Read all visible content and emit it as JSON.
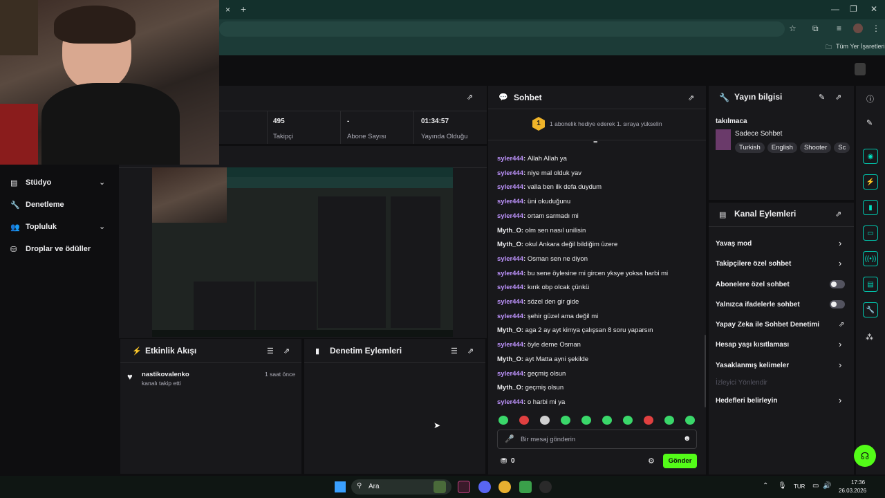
{
  "browser": {
    "bookmarks_label": "Tüm Yer İşaretleri",
    "tab_close": "×",
    "tab_new": "+"
  },
  "stats": [
    {
      "value": "495",
      "label": "Takipçi"
    },
    {
      "value": "-",
      "label": "Abone Sayısı"
    },
    {
      "value": "01:34:57",
      "label": "Yayında Olduğu"
    }
  ],
  "sidebar": {
    "items": [
      {
        "label": "Stüdyo",
        "icon": "studio-icon",
        "expandable": true
      },
      {
        "label": "Denetleme",
        "icon": "wrench-icon",
        "expandable": false
      },
      {
        "label": "Topluluk",
        "icon": "community-icon",
        "expandable": true
      },
      {
        "label": "Droplar ve ödüller",
        "icon": "drops-icon",
        "expandable": false
      }
    ]
  },
  "activity": {
    "title": "Etkinlik Akışı",
    "items": [
      {
        "user": "nastikovalenko",
        "text": "kanalı takip etti",
        "time": "1 saat önce"
      }
    ]
  },
  "mod_actions": {
    "title": "Denetim Eylemleri"
  },
  "chat": {
    "title": "Sohbet",
    "gift_badge": "1",
    "gift_text": "1 abonelik hediye ederek 1. sıraya yükselin",
    "messages": [
      {
        "user": "syler444",
        "text": "Allah Allah ya",
        "color": "purple"
      },
      {
        "user": "syler444",
        "text": "niye mal olduk yav",
        "color": "purple"
      },
      {
        "user": "syler444",
        "text": "valla ben ilk defa duydum",
        "color": "purple"
      },
      {
        "user": "syler444",
        "text": "üni okuduğunu",
        "color": "purple"
      },
      {
        "user": "syler444",
        "text": "ortam sarmadı mi",
        "color": "purple"
      },
      {
        "user": "Myth_O",
        "text": "olm sen nasıl unilisin",
        "color": "white"
      },
      {
        "user": "Myth_O",
        "text": "okul Ankara değil bildiğim üzere",
        "color": "white"
      },
      {
        "user": "syler444",
        "text": "Osman sen ne diyon",
        "color": "purple"
      },
      {
        "user": "syler444",
        "text": "bu sene öylesine mi gircen yksye yoksa harbi mi",
        "color": "purple"
      },
      {
        "user": "syler444",
        "text": "kırık obp olcak çünkü",
        "color": "purple"
      },
      {
        "user": "syler444",
        "text": "sözel den gir gide",
        "color": "purple"
      },
      {
        "user": "syler444",
        "text": "şehir güzel ama değil mi",
        "color": "purple"
      },
      {
        "user": "Myth_O",
        "text": "aga 2 ay ayt kimya çalışsan 8 soru yaparsın",
        "color": "white"
      },
      {
        "user": "syler444",
        "text": "öyle deme Osman",
        "color": "purple"
      },
      {
        "user": "Myth_O",
        "text": "ayt Matta ayni şekilde",
        "color": "white"
      },
      {
        "user": "syler444",
        "text": "geçmiş olsun",
        "color": "purple"
      },
      {
        "user": "Myth_O",
        "text": "geçmiş olsun",
        "color": "white"
      },
      {
        "user": "syler444",
        "text": "o harbi mi ya",
        "color": "purple"
      }
    ],
    "input_placeholder": "Bir mesaj gönderin",
    "points": "0",
    "send_label": "Gönder"
  },
  "stream_info": {
    "title": "Yayın bilgisi",
    "stream_title": "takılmaca",
    "category": "Sadece Sohbet",
    "tags": [
      "Turkish",
      "English",
      "Shooter",
      "Sc"
    ]
  },
  "channel_actions": {
    "title": "Kanal Eylemleri",
    "items": [
      {
        "label": "Yavaş mod",
        "control": "chevron"
      },
      {
        "label": "Takipçilere özel sohbet",
        "control": "chevron"
      },
      {
        "label": "Abonelere özel sohbet",
        "control": "toggle"
      },
      {
        "label": "Yalnızca ifadelerle sohbet",
        "control": "toggle"
      },
      {
        "label": "Yapay Zeka ile Sohbet Denetimi",
        "control": "external"
      },
      {
        "label": "Hesap yaşı kısıtlaması",
        "control": "chevron"
      },
      {
        "label": "Yasaklanmış kelimeler",
        "control": "chevron"
      },
      {
        "label": "İzleyici Yönlendir",
        "control": "disabled"
      },
      {
        "label": "Hedefleri belirleyin",
        "control": "chevron"
      }
    ]
  },
  "taskbar": {
    "search_label": "Ara",
    "lang": "TUR",
    "time": "17:36",
    "date": "26.03.2026"
  },
  "colors": {
    "accent": "#00e0c0",
    "send_button": "#53fc18",
    "username_purple": "#bf94ff",
    "browser_frame": "#13302c"
  }
}
